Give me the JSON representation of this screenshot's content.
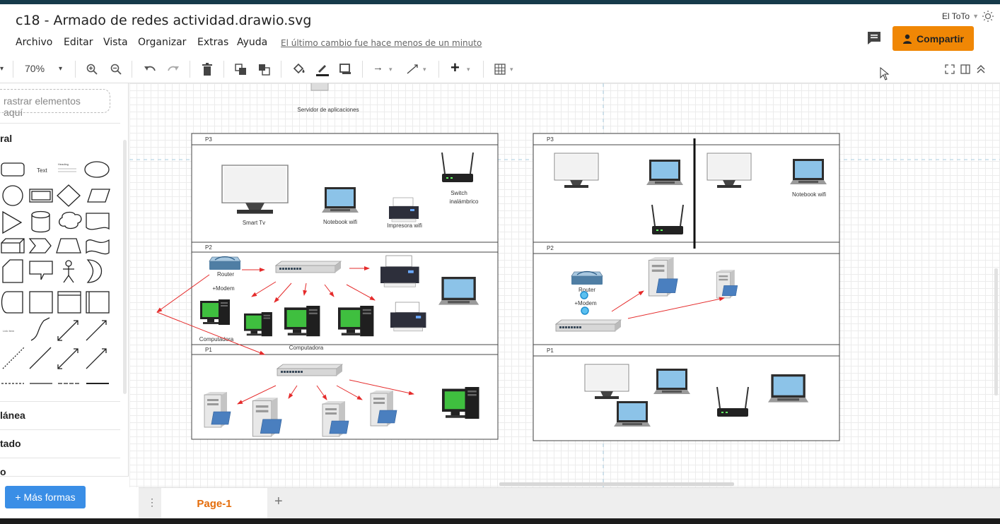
{
  "window": {
    "title": "c18 - Armado de redes actividad.drawio.svg",
    "user": "El ToTo"
  },
  "menu": {
    "items": [
      "Archivo",
      "Editar",
      "Vista",
      "Organizar",
      "Extras",
      "Ayuda"
    ],
    "last_change": "El último cambio fue hace menos de un minuto"
  },
  "share": {
    "label": "Compartir"
  },
  "toolbar": {
    "zoom": "70%"
  },
  "sidebar": {
    "search_placeholder": "rastrar elementos aquí",
    "general_label": "ral",
    "misc_label": "lánea",
    "advanced_label": "tado",
    "extra_label": "o",
    "more_shapes": "+ Más formas",
    "text_shape": "Text",
    "heading_shape": "Heading",
    "link_shape": "Link Item"
  },
  "diagram": {
    "app_server": "Servidor de aplicaciones",
    "left": {
      "p3": "P3",
      "p2": "P2",
      "p1": "P1",
      "smart_tv": "Smart Tv",
      "notebook": "Notebook wifi",
      "printer": "Impresora wifi",
      "switch1": "Switch",
      "switch2": "inalámbrico",
      "router": "Router",
      "modem": "+Modem",
      "computer1": "Computadora",
      "computer2": "Computadora"
    },
    "right": {
      "p3": "P3",
      "p2": "P2",
      "p1": "P1",
      "notebook": "Notebook wifi",
      "router": "Router",
      "modem": "+Modem"
    }
  },
  "pages": {
    "current": "Page-1"
  }
}
